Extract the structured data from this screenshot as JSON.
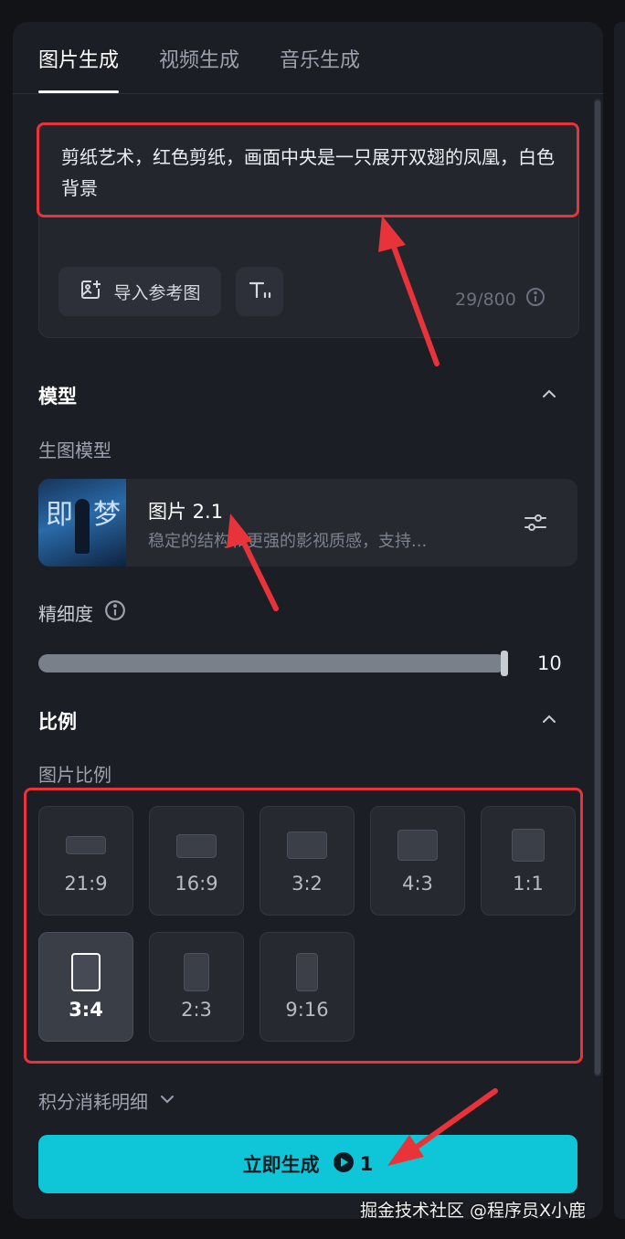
{
  "tabs": [
    {
      "label": "图片生成",
      "active": true
    },
    {
      "label": "视频生成",
      "active": false
    },
    {
      "label": "音乐生成",
      "active": false
    }
  ],
  "prompt": {
    "text": "剪纸艺术，红色剪纸，画面中央是一只展开双翅的凤凰，白色背景",
    "import_label": "导入参考图",
    "counter": "29/800"
  },
  "model_section": {
    "title": "模型",
    "sub_label": "生图模型",
    "thumb_text_1": "即",
    "thumb_text_2": "梦",
    "model_name": "图片 2.1",
    "model_desc": "稳定的结构和更强的影视质感，支持..."
  },
  "precision": {
    "label": "精细度",
    "value": "10",
    "level": 1.0
  },
  "ratio_section": {
    "title": "比例",
    "sub_label": "图片比例",
    "ratios": [
      {
        "label": "21:9",
        "selected": false
      },
      {
        "label": "16:9",
        "selected": false
      },
      {
        "label": "3:2",
        "selected": false
      },
      {
        "label": "4:3",
        "selected": false
      },
      {
        "label": "1:1",
        "selected": false
      },
      {
        "label": "3:4",
        "selected": true
      },
      {
        "label": "2:3",
        "selected": false
      },
      {
        "label": "9:16",
        "selected": false
      }
    ]
  },
  "points_label": "积分消耗明细",
  "generate": {
    "label": "立即生成",
    "cost": "1"
  },
  "watermark": "掘金技术社区 @程序员X小鹿",
  "colors": {
    "accent": "#0fc6d8",
    "highlight": "#e8333a",
    "panel": "#1b1e24"
  }
}
